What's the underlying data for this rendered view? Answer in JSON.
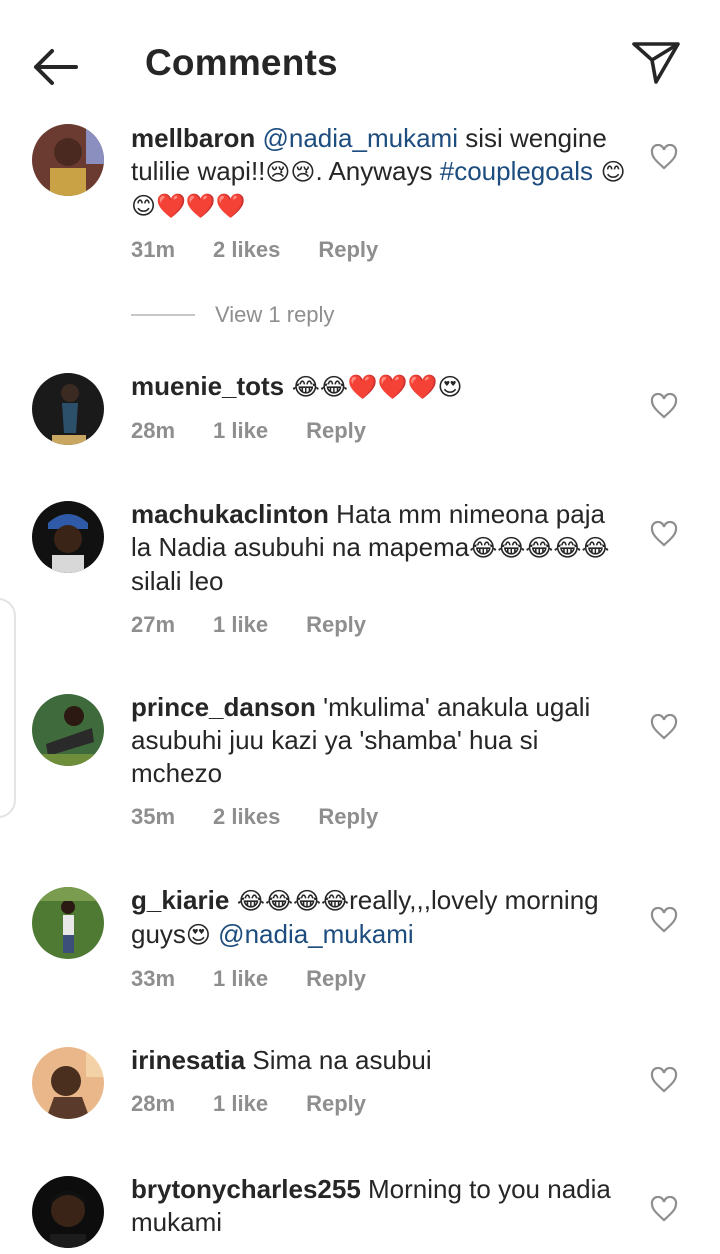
{
  "header": {
    "title": "Comments"
  },
  "comments": [
    {
      "username": "mellbaron",
      "mention": "@nadia_mukami",
      "text": " sisi wengine tulilie wapi!!",
      "emoji1": "😢😢",
      "text2": ". Anyways ",
      "hashtag": "#couplegoals",
      "emoji2": " 😊😊❤️❤️❤️",
      "time": "31m",
      "likes": "2 likes",
      "reply": "Reply",
      "view_replies": "View 1 reply"
    },
    {
      "username": "muenie_tots",
      "emoji": " 😂😂❤️❤️❤️😍",
      "time": "28m",
      "likes": "1 like",
      "reply": "Reply"
    },
    {
      "username": "machukaclinton",
      "text": " Hata mm nimeona paja la Nadia asubuhi na mapema",
      "emoji": "😂😂😂😂😂",
      "text2": " silali leo",
      "time": "27m",
      "likes": "1 like",
      "reply": "Reply"
    },
    {
      "username": "prince_danson",
      "text": " 'mkulima' anakula ugali asubuhi juu kazi ya 'shamba' hua si mchezo",
      "time": "35m",
      "likes": "2 likes",
      "reply": "Reply"
    },
    {
      "username": "g_kiarie",
      "emoji": " 😂😂😂😂",
      "text": "really,,,lovely morning guys",
      "emoji2": "😍",
      "mention": " @nadia_mukami",
      "time": "33m",
      "likes": "1 like",
      "reply": "Reply"
    },
    {
      "username": "irinesatia",
      "text": " Sima na asubui",
      "time": "28m",
      "likes": "1 like",
      "reply": "Reply"
    },
    {
      "username": "brytonycharles255",
      "text": " Morning to you nadia mukami"
    }
  ],
  "icons": {
    "back": "arrow-left-icon",
    "send": "paper-plane-icon",
    "like": "heart-outline-icon"
  },
  "colors": {
    "text": "#262626",
    "muted": "#8e8e8e",
    "mention": "#1d4c7e"
  }
}
